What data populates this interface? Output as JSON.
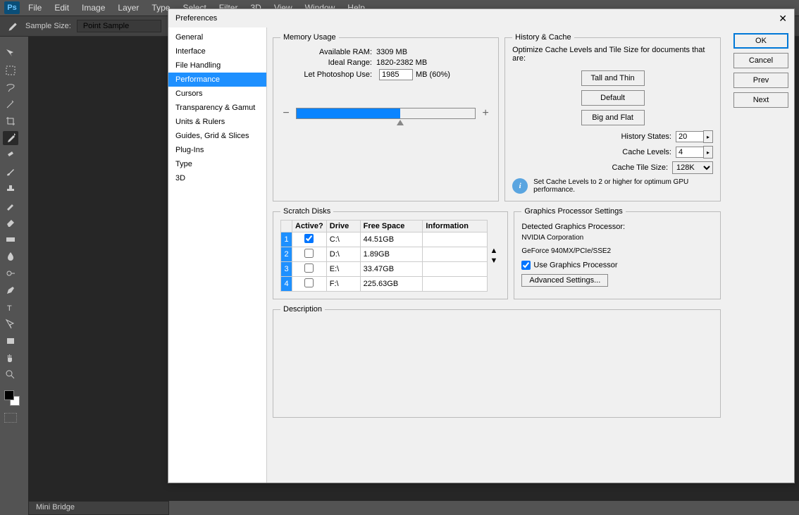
{
  "app": {
    "logo": "Ps"
  },
  "menu": [
    "File",
    "Edit",
    "Image",
    "Layer",
    "Type",
    "Select",
    "Filter",
    "3D",
    "View",
    "Window",
    "Help"
  ],
  "optbar": {
    "sample_size_label": "Sample Size:",
    "sample_size_value": "Point Sample"
  },
  "minibridge": "Mini Bridge",
  "dialog": {
    "title": "Preferences",
    "categories": [
      "General",
      "Interface",
      "File Handling",
      "Performance",
      "Cursors",
      "Transparency & Gamut",
      "Units & Rulers",
      "Guides, Grid & Slices",
      "Plug-Ins",
      "Type",
      "3D"
    ],
    "selected_category": "Performance",
    "buttons": {
      "ok": "OK",
      "cancel": "Cancel",
      "prev": "Prev",
      "next": "Next"
    },
    "memory": {
      "legend": "Memory Usage",
      "available_label": "Available RAM:",
      "available_value": "3309 MB",
      "ideal_label": "Ideal Range:",
      "ideal_value": "1820-2382 MB",
      "let_label": "Let Photoshop Use:",
      "let_value": "1985",
      "let_suffix": "MB (60%)",
      "minus": "−",
      "plus": "+"
    },
    "history": {
      "legend": "History & Cache",
      "text": "Optimize Cache Levels and Tile Size for documents that are:",
      "btn_tall": "Tall and Thin",
      "btn_default": "Default",
      "btn_big": "Big and Flat",
      "states_label": "History States:",
      "states_value": "20",
      "levels_label": "Cache Levels:",
      "levels_value": "4",
      "tile_label": "Cache Tile Size:",
      "tile_value": "128K",
      "info": "Set Cache Levels to 2 or higher for optimum GPU performance."
    },
    "scratch": {
      "legend": "Scratch Disks",
      "headers": {
        "active": "Active?",
        "drive": "Drive",
        "free": "Free Space",
        "info": "Information"
      },
      "rows": [
        {
          "n": "1",
          "active": true,
          "drive": "C:\\",
          "free": "44.51GB",
          "info": ""
        },
        {
          "n": "2",
          "active": false,
          "drive": "D:\\",
          "free": "1.89GB",
          "info": ""
        },
        {
          "n": "3",
          "active": false,
          "drive": "E:\\",
          "free": "33.47GB",
          "info": ""
        },
        {
          "n": "4",
          "active": false,
          "drive": "F:\\",
          "free": "225.63GB",
          "info": ""
        }
      ]
    },
    "gpu": {
      "legend": "Graphics Processor Settings",
      "detected_label": "Detected Graphics Processor:",
      "vendor": "NVIDIA Corporation",
      "model": "GeForce 940MX/PCIe/SSE2",
      "use_label": "Use Graphics Processor",
      "adv_btn": "Advanced Settings..."
    },
    "description": {
      "legend": "Description"
    }
  }
}
